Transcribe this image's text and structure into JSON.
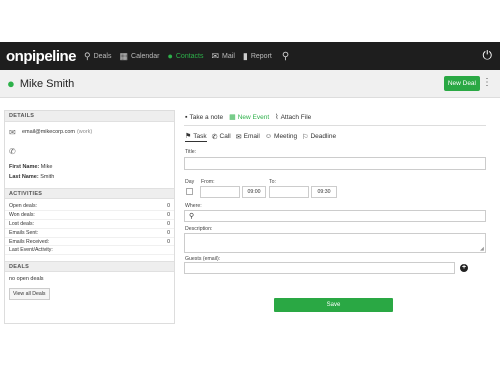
{
  "nav": {
    "logo": "onpipeline",
    "items": [
      {
        "label": "Deals",
        "icon": "filter-icon"
      },
      {
        "label": "Calendar",
        "icon": "calendar-icon"
      },
      {
        "label": "Contacts",
        "icon": "person-icon",
        "active": true
      },
      {
        "label": "Mail",
        "icon": "mail-icon"
      },
      {
        "label": "Report",
        "icon": "bar-chart-icon"
      }
    ],
    "search_icon": "search-icon",
    "power_icon": "power-icon"
  },
  "header": {
    "name": "Mike Smith",
    "new_deal": "New Deal"
  },
  "details": {
    "title": "DETAILS",
    "email": "email@mikecorp.com",
    "email_type": "(work)",
    "first_name_label": "First Name:",
    "first_name": "Mike",
    "last_name_label": "Last Name:",
    "last_name": "Smith"
  },
  "activities": {
    "title": "ACTIVITIES",
    "rows": [
      {
        "label": "Open deals:",
        "value": "0"
      },
      {
        "label": "Won deals:",
        "value": "0"
      },
      {
        "label": "Lost deals:",
        "value": "0"
      },
      {
        "label": "Emails Sent:",
        "value": "0"
      },
      {
        "label": "Emails Received:",
        "value": "0"
      },
      {
        "label": "Last Event/Activity:",
        "value": ""
      }
    ]
  },
  "deals": {
    "title": "DEALS",
    "empty": "no open deals",
    "view_all": "View all Deals"
  },
  "tabs_top": [
    {
      "label": "Take a note",
      "icon": "note-icon"
    },
    {
      "label": "New Event",
      "icon": "calendar-icon",
      "active": true
    },
    {
      "label": "Attach File",
      "icon": "paperclip-icon"
    }
  ],
  "tabs_event": [
    {
      "label": "Task",
      "icon": "task-icon",
      "active": true
    },
    {
      "label": "Call",
      "icon": "phone-icon"
    },
    {
      "label": "Email",
      "icon": "mail-icon"
    },
    {
      "label": "Meeting",
      "icon": "meeting-icon"
    },
    {
      "label": "Deadline",
      "icon": "flag-icon"
    }
  ],
  "form": {
    "title_label": "Title:",
    "day_label": "Day",
    "from_label": "From:",
    "from_time": "09:00",
    "to_label": "To:",
    "to_time": "09:30",
    "where_label": "Where:",
    "description_label": "Description:",
    "guests_label": "Guests (email):",
    "save": "Save"
  },
  "colors": {
    "accent": "#2aa844",
    "navbar": "#1e1e1e"
  }
}
